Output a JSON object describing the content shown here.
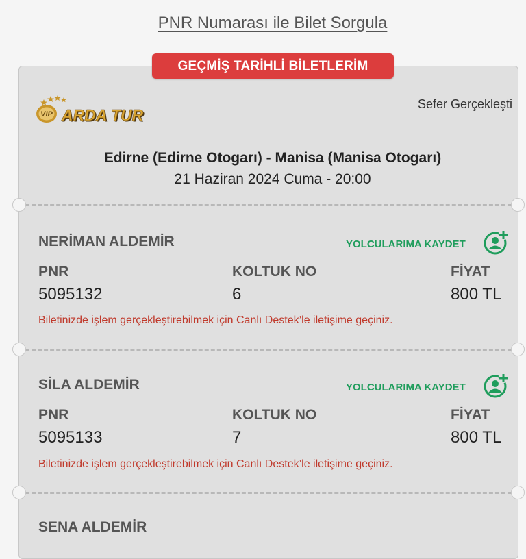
{
  "header": {
    "pnr_query_link": "PNR Numarası ile Bilet Sorgula"
  },
  "tab": {
    "past_tickets": "GEÇMİŞ TARİHLİ BİLETLERİM"
  },
  "ticket": {
    "company": {
      "logo_text": "ARDA TUR",
      "logo_badge": "VIP"
    },
    "status": "Sefer Gerçekleşti",
    "route": "Edirne (Edirne Otogarı) - Manisa (Manisa Otogarı)",
    "date": "21 Haziran 2024 Cuma - 20:00",
    "labels": {
      "pnr": "PNR",
      "seat": "KOLTUK NO",
      "price": "FİYAT",
      "save": "YOLCULARIMA KAYDET"
    },
    "notice": "Biletinizde işlem gerçekleştirebilmek için Canlı Destek’le iletişime geçiniz.",
    "passengers": [
      {
        "name": "NERİMAN ALDEMİR",
        "pnr": "5095132",
        "seat": "6",
        "price": "800 TL"
      },
      {
        "name": "SİLA ALDEMİR",
        "pnr": "5095133",
        "seat": "7",
        "price": "800 TL"
      },
      {
        "name": "SENA ALDEMİR"
      }
    ]
  },
  "colors": {
    "accent_red": "#dc3d3d",
    "save_green": "#1f9d5c",
    "notice_red": "#c0392b",
    "logo_gold": "#c9962b"
  },
  "icons": {
    "save_passenger": "add-user-icon",
    "logo_stars": "star-icon"
  }
}
